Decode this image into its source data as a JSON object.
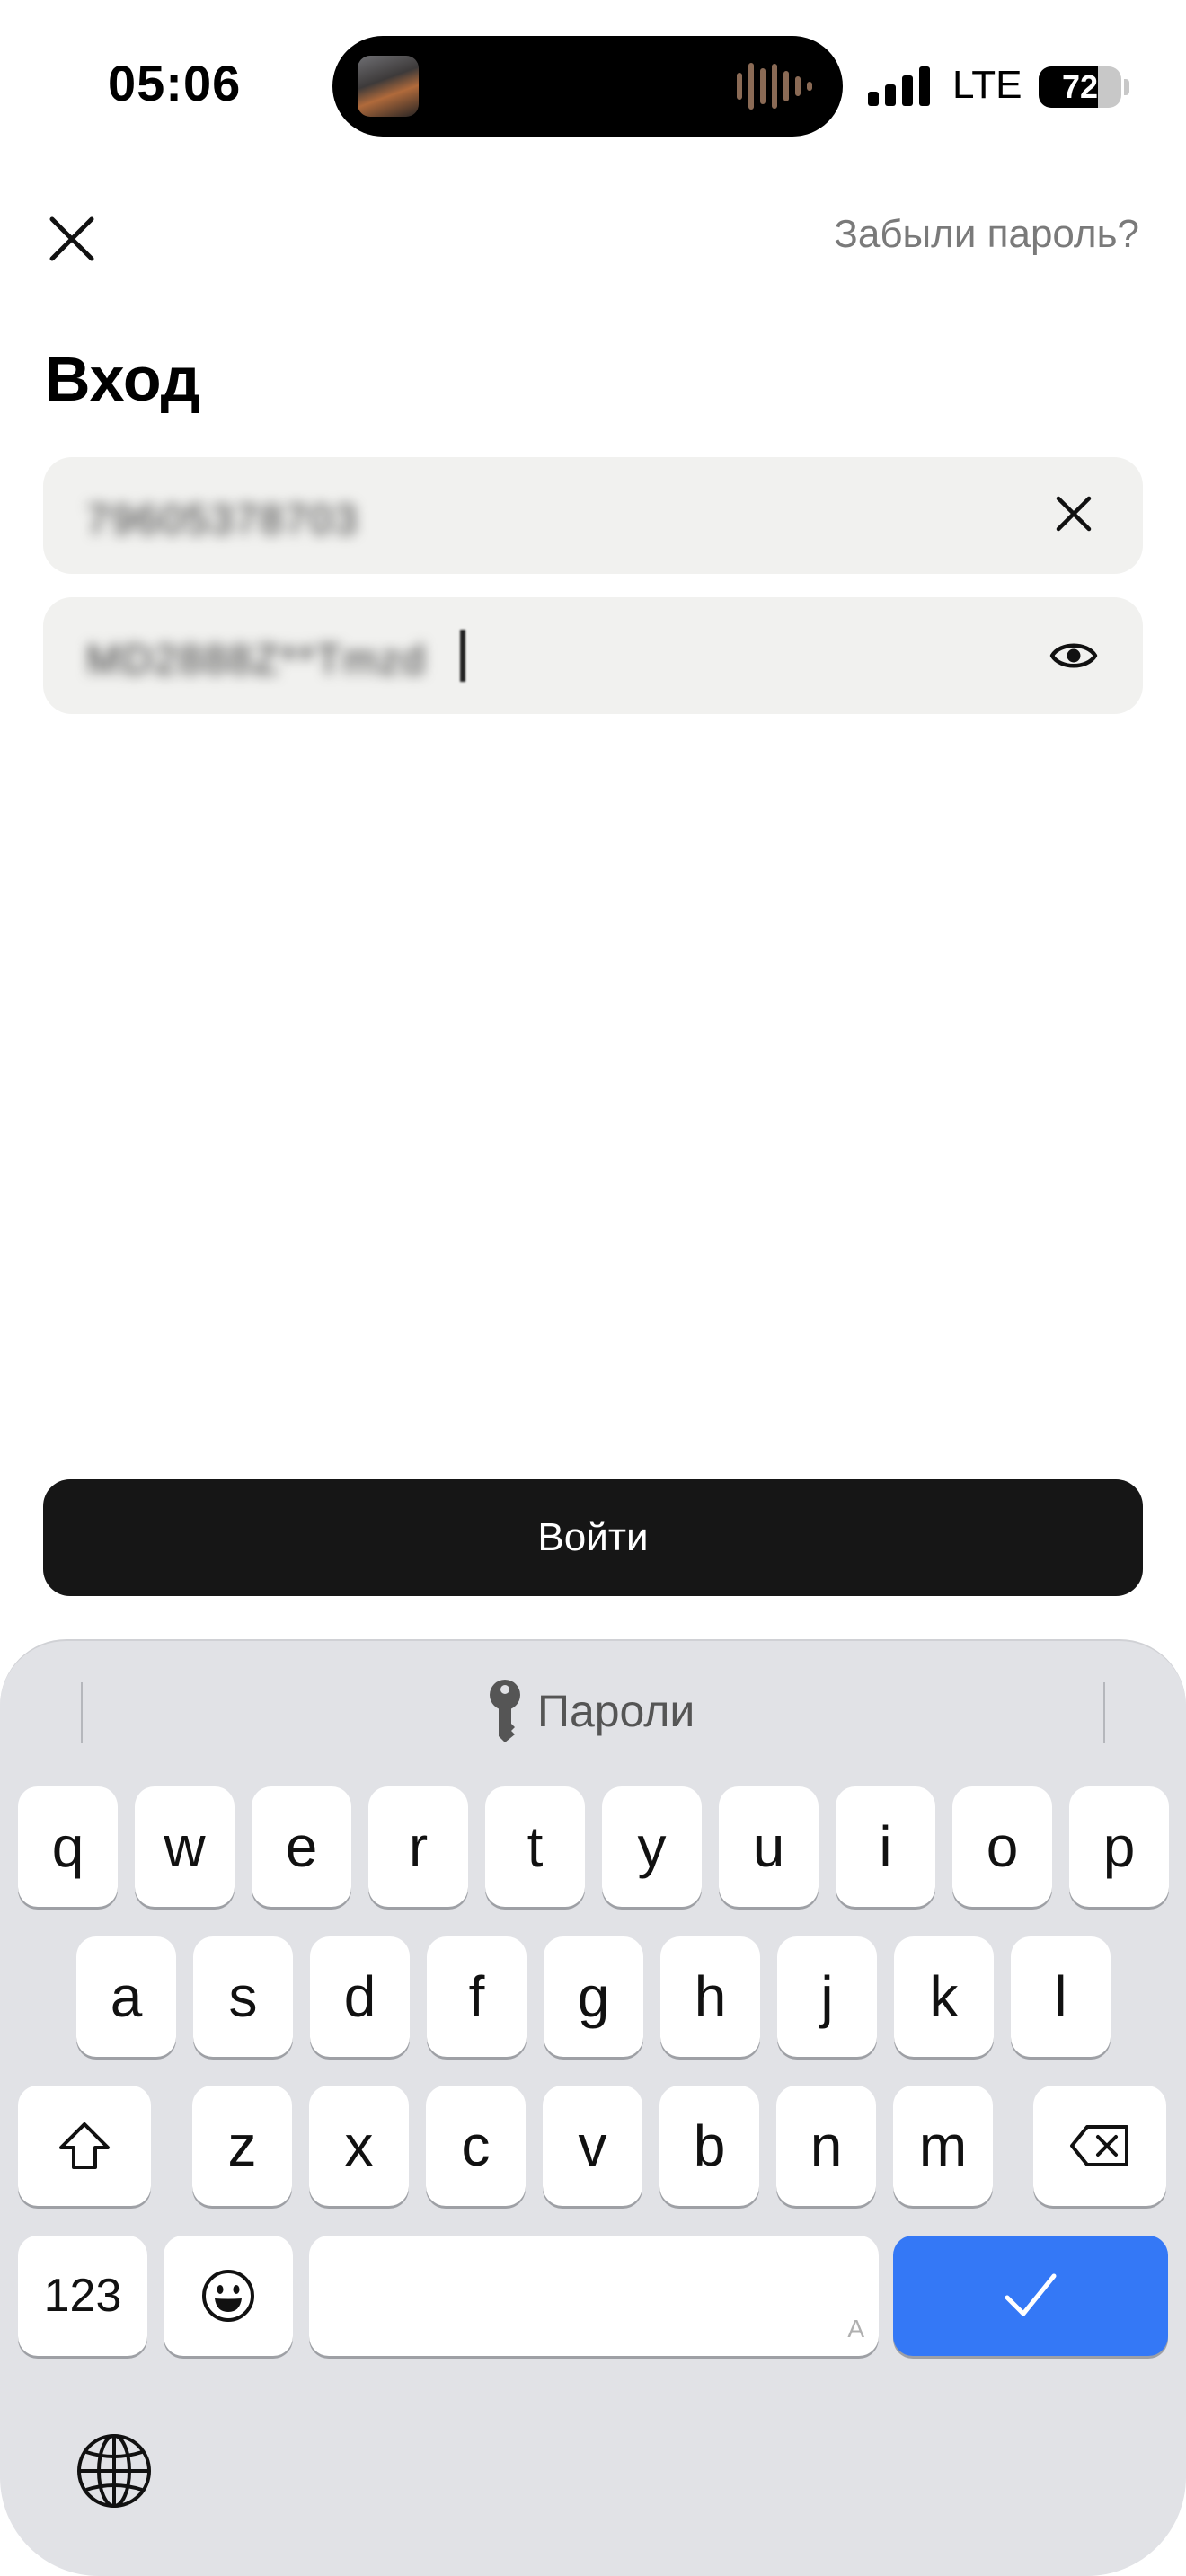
{
  "status_bar": {
    "time": "05:06",
    "network": "LTE",
    "battery": "72",
    "battery_level": 0.72
  },
  "header": {
    "close_icon": "close-icon",
    "forgot_link": "Забыли пароль?"
  },
  "page": {
    "title": "Вход"
  },
  "form": {
    "login_value": "79605378703",
    "password_value": "MD2888Z**Tmzd",
    "login_clear_icon": "clear-icon",
    "password_toggle_icon": "eye-icon"
  },
  "submit": {
    "label": "Войти"
  },
  "keyboard": {
    "suggestion_label": "Пароли",
    "row1": [
      "q",
      "w",
      "e",
      "r",
      "t",
      "y",
      "u",
      "i",
      "o",
      "p"
    ],
    "row2": [
      "a",
      "s",
      "d",
      "f",
      "g",
      "h",
      "j",
      "k",
      "l"
    ],
    "row3": [
      "z",
      "x",
      "c",
      "v",
      "b",
      "n",
      "m"
    ],
    "numbers_label": "123",
    "space_hint": "A",
    "accent_color": "#3478f6"
  }
}
